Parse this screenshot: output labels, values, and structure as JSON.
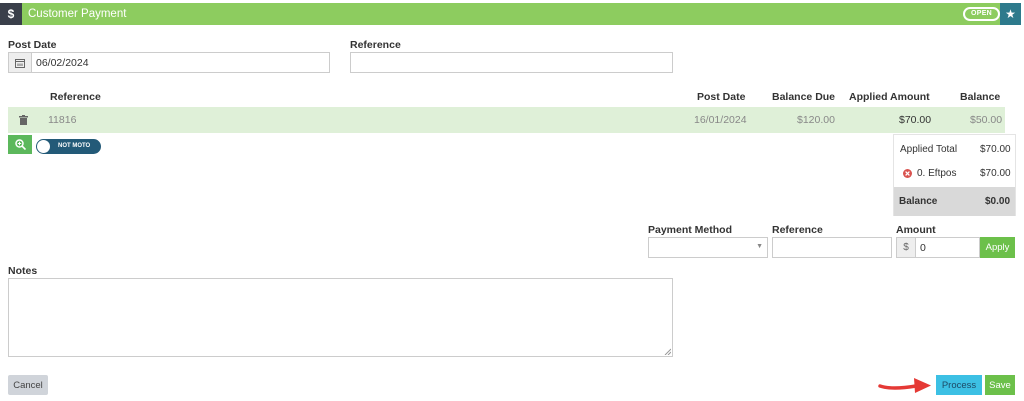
{
  "header": {
    "icon": "$",
    "title": "Customer Payment",
    "status": "OPEN",
    "accent": "#8dcc5f"
  },
  "form": {
    "post_date_label": "Post Date",
    "post_date_value": "06/02/2024",
    "reference_label": "Reference",
    "reference_value": ""
  },
  "table": {
    "headers": {
      "reference": "Reference",
      "post_date": "Post Date",
      "balance_due": "Balance Due",
      "applied_amount": "Applied Amount",
      "balance": "Balance"
    },
    "rows": [
      {
        "reference": "11816",
        "post_date": "16/01/2024",
        "balance_due": "$120.00",
        "applied_amount": "$70.00",
        "balance": "$50.00"
      }
    ]
  },
  "toggle": {
    "label": "NOT MOTO",
    "state": "off"
  },
  "summary": {
    "applied_total_label": "Applied Total",
    "applied_total_value": "$70.00",
    "payments": [
      {
        "label": "0. Eftpos",
        "value": "$70.00"
      }
    ],
    "balance_label": "Balance",
    "balance_value": "$0.00"
  },
  "payment": {
    "method_label": "Payment Method",
    "method_value": "",
    "reference_label": "Reference",
    "reference_value": "",
    "amount_label": "Amount",
    "currency": "$",
    "amount_value": "0",
    "apply_label": "Apply"
  },
  "notes": {
    "label": "Notes",
    "value": ""
  },
  "buttons": {
    "cancel": "Cancel",
    "process": "Process",
    "save": "Save"
  },
  "colors": {
    "process": "#3cc0e4",
    "save": "#6cc04a",
    "arrow": "#e53935"
  }
}
